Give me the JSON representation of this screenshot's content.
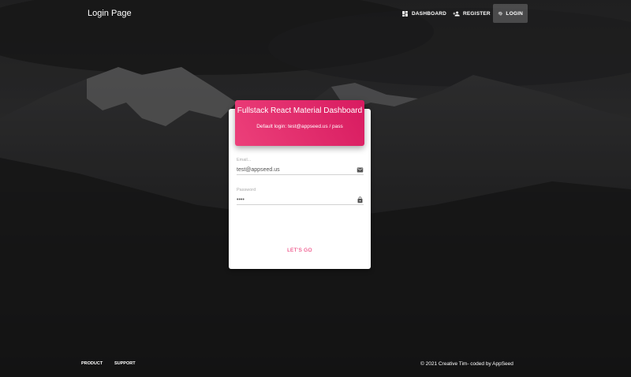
{
  "navbar": {
    "brand": "Login Page",
    "items": [
      {
        "label": "DASHBOARD",
        "icon": "dashboard-icon"
      },
      {
        "label": "REGISTER",
        "icon": "person-add-icon"
      },
      {
        "label": "LOGIN",
        "icon": "fingerprint-icon"
      }
    ]
  },
  "card": {
    "title": "Fullstack React Material Dashboard",
    "subtitle": "Default login: test@appseed.us / pass",
    "email": {
      "label": "Email...",
      "value": "test@appseed.us",
      "icon": "email-icon"
    },
    "password": {
      "label": "Password",
      "value": "••••",
      "icon": "lock-icon"
    },
    "submit_label": "LET'S GO"
  },
  "footer": {
    "links": [
      "PRODUCT",
      "SUPPORT"
    ],
    "copyright": "© 2021 Creative Tim- coded by AppSeed"
  },
  "colors": {
    "accent": "#e91e63",
    "header_gradient_start": "#ec407a",
    "header_gradient_end": "#d81b60"
  }
}
